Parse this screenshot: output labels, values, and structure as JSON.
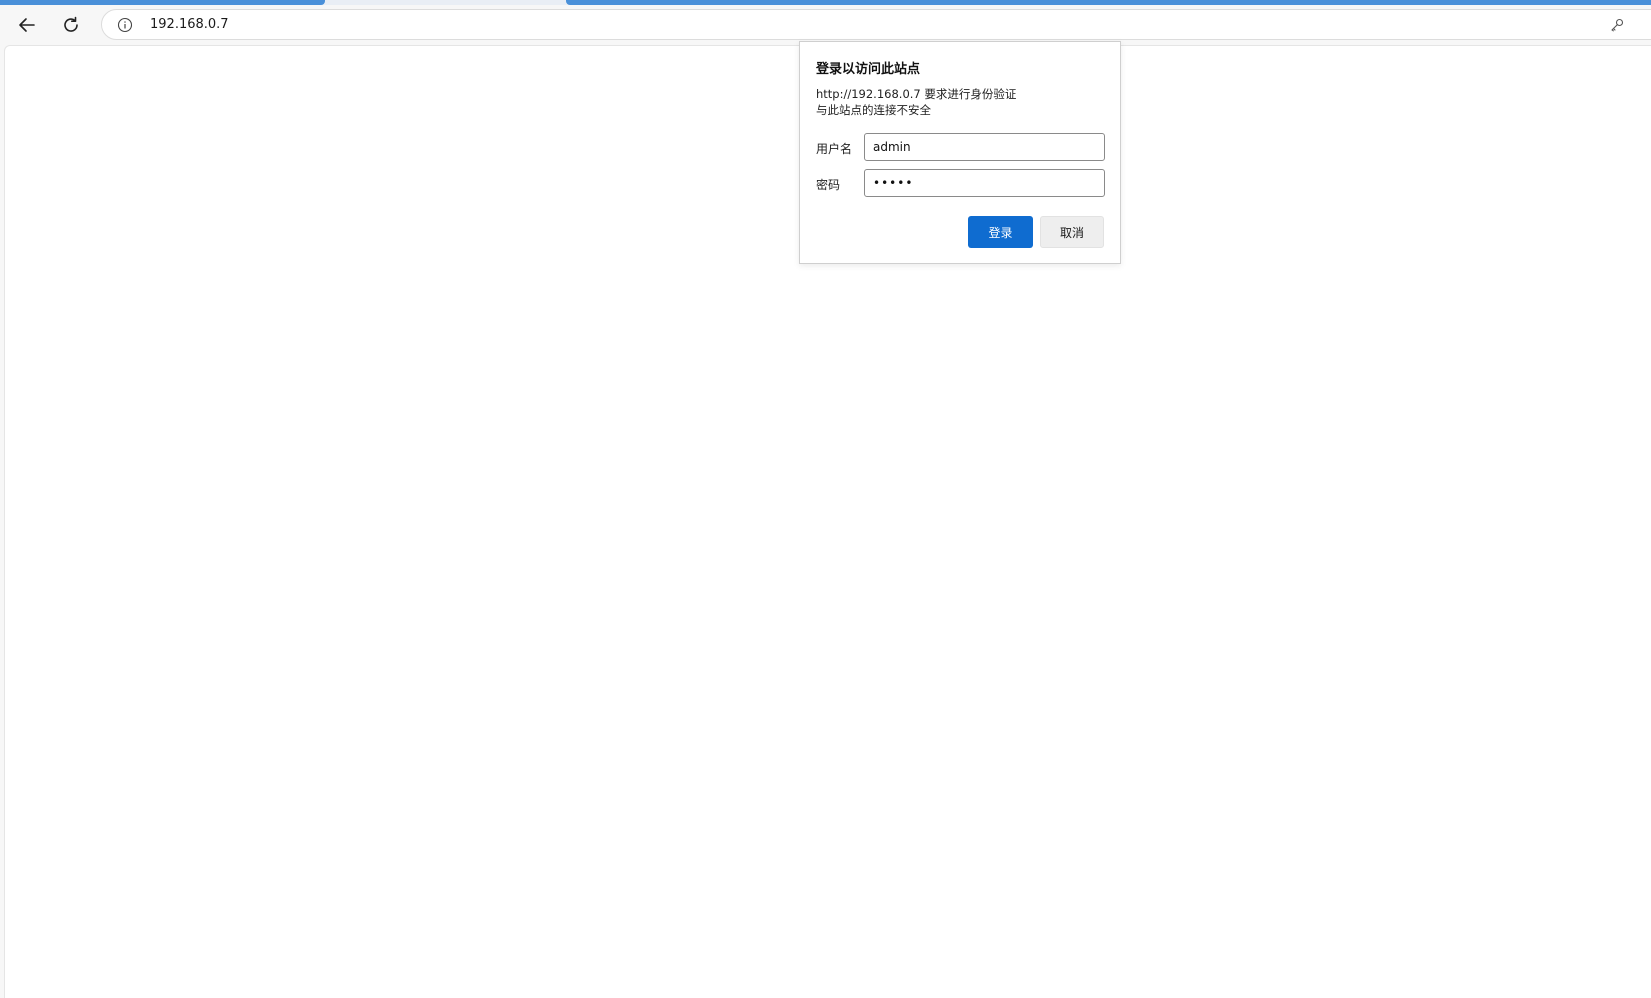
{
  "browser": {
    "address_bar": {
      "url": "192.168.0.7"
    },
    "icons": {
      "back": "back-arrow-icon",
      "reload": "reload-icon",
      "site_info": "info-icon",
      "passwords": "key-icon"
    },
    "colors": {
      "tab_accent": "#4a90d9",
      "toolbar_bg": "#f7f7f7"
    }
  },
  "auth_dialog": {
    "title": "登录以访问此站点",
    "message_line1": "http://192.168.0.7 要求进行身份验证",
    "message_line2": "与此站点的连接不安全",
    "username_label": "用户名",
    "username_value": "admin",
    "password_label": "密码",
    "password_masked": "•••••",
    "login_button": "登录",
    "cancel_button": "取消",
    "colors": {
      "primary_button": "#0f6cd0",
      "secondary_button": "#eeeeee"
    }
  }
}
